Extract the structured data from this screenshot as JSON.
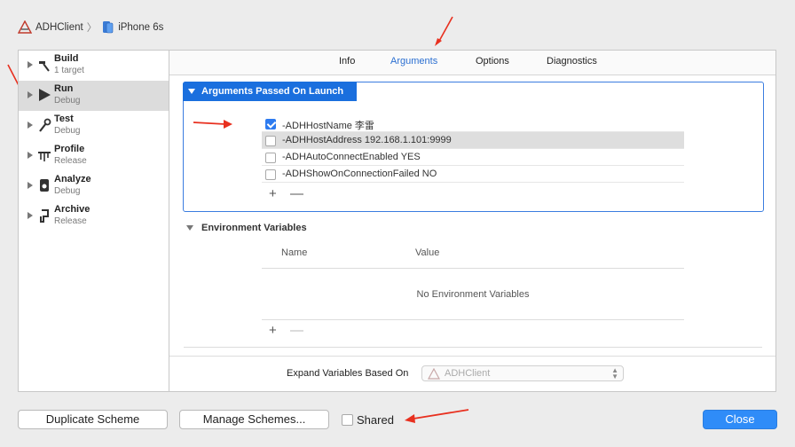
{
  "breadcrumb": {
    "project": "ADHClient",
    "device": "iPhone 6s"
  },
  "sidebar": {
    "items": [
      {
        "name": "Build",
        "sub": "1 target",
        "icon": "hammer-icon"
      },
      {
        "name": "Run",
        "sub": "Debug",
        "icon": "play-icon"
      },
      {
        "name": "Test",
        "sub": "Debug",
        "icon": "wrench-icon"
      },
      {
        "name": "Profile",
        "sub": "Release",
        "icon": "instruments-icon"
      },
      {
        "name": "Analyze",
        "sub": "Debug",
        "icon": "analyze-icon"
      },
      {
        "name": "Archive",
        "sub": "Release",
        "icon": "archive-icon"
      }
    ],
    "selected": "Run"
  },
  "tabs": [
    "Info",
    "Arguments",
    "Options",
    "Diagnostics"
  ],
  "selected_tab": "Arguments",
  "arguments": {
    "title": "Arguments Passed On Launch",
    "items": [
      {
        "text": "-ADHHostName 李雷",
        "checked": true
      },
      {
        "text": "-ADHHostAddress 192.168.1.101:9999",
        "checked": false
      },
      {
        "text": "-ADHAutoConnectEnabled YES",
        "checked": false
      },
      {
        "text": "-ADHShowOnConnectionFailed NO",
        "checked": false
      }
    ],
    "add": "+",
    "remove": "—"
  },
  "environment": {
    "title": "Environment Variables",
    "col_name": "Name",
    "col_value": "Value",
    "empty_text": "No Environment Variables",
    "add": "+",
    "remove": "—"
  },
  "expand": {
    "label": "Expand Variables Based On",
    "value": "ADHClient"
  },
  "footer": {
    "duplicate": "Duplicate Scheme",
    "manage": "Manage Schemes...",
    "shared": "Shared",
    "close": "Close"
  },
  "colors": {
    "accent": "#1a6fde",
    "annotation": "#e8301f"
  }
}
